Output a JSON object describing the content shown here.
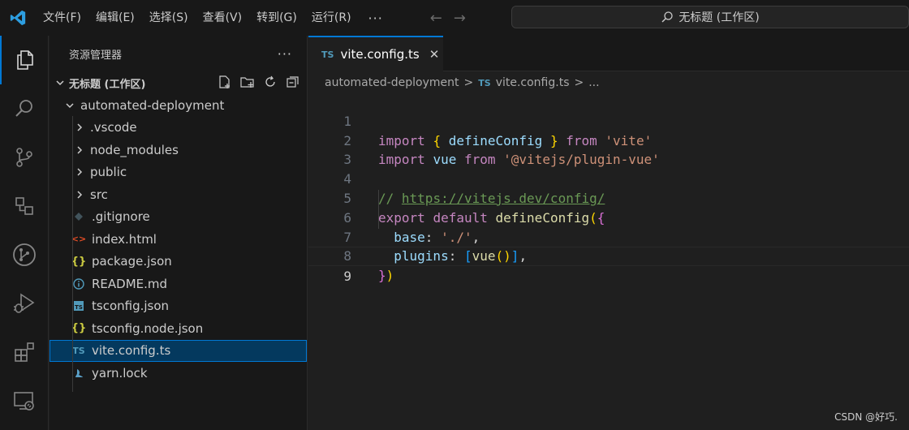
{
  "titlebar": {
    "menu": [
      "文件(F)",
      "编辑(E)",
      "选择(S)",
      "查看(V)",
      "转到(G)",
      "运行(R)"
    ],
    "more": "···",
    "nav_back": "←",
    "nav_forward": "→",
    "command_center": "无标题 (工作区)"
  },
  "sidebar": {
    "title": "资源管理器",
    "more": "···",
    "workspace": "无标题 (工作区)",
    "root_folder": "automated-deployment",
    "items": [
      {
        "label": ".vscode",
        "type": "folder"
      },
      {
        "label": "node_modules",
        "type": "folder"
      },
      {
        "label": "public",
        "type": "folder"
      },
      {
        "label": "src",
        "type": "folder"
      },
      {
        "label": ".gitignore",
        "type": "git"
      },
      {
        "label": "index.html",
        "type": "html"
      },
      {
        "label": "package.json",
        "type": "json"
      },
      {
        "label": "README.md",
        "type": "info"
      },
      {
        "label": "tsconfig.json",
        "type": "tsconfig"
      },
      {
        "label": "tsconfig.node.json",
        "type": "json"
      },
      {
        "label": "vite.config.ts",
        "type": "ts",
        "selected": true
      },
      {
        "label": "yarn.lock",
        "type": "yarn"
      }
    ]
  },
  "editor": {
    "tab_badge": "TS",
    "tab_label": "vite.config.ts",
    "tab_close": "✕",
    "breadcrumb": {
      "folder": "automated-deployment",
      "sep": ">",
      "badge": "TS",
      "file": "vite.config.ts",
      "tail": "..."
    },
    "line_numbers": [
      "1",
      "2",
      "3",
      "4",
      "5",
      "6",
      "7",
      "8",
      "9"
    ],
    "code": {
      "l1_import": "import",
      "l1_open": "{",
      "l1_name": "defineConfig",
      "l1_close": "}",
      "l1_from": "from",
      "l1_str": "'vite'",
      "l2_import": "import",
      "l2_name": "vue",
      "l2_from": "from",
      "l2_str": "'@vitejs/plugin-vue'",
      "l4_comment": "//",
      "l4_link": "https://vitejs.dev/config/",
      "l5_export": "export",
      "l5_default": "default",
      "l5_fn": "defineConfig",
      "l5_paren": "(",
      "l5_brace": "{",
      "l6_key": "base",
      "l6_colon": ":",
      "l6_str": "'./'",
      "l6_comma": ",",
      "l7_key": "plugins",
      "l7_colon": ":",
      "l7_open": "[",
      "l7_fn": "vue",
      "l7_parens": "()",
      "l7_close": "]",
      "l7_comma": ",",
      "l8_brace": "}",
      "l8_paren": ")"
    }
  },
  "watermark": "CSDN @好巧.",
  "colors": {
    "accent": "#0078d4",
    "ts_blue": "#519aba",
    "keyword": "#c586c0",
    "string": "#ce9178"
  }
}
